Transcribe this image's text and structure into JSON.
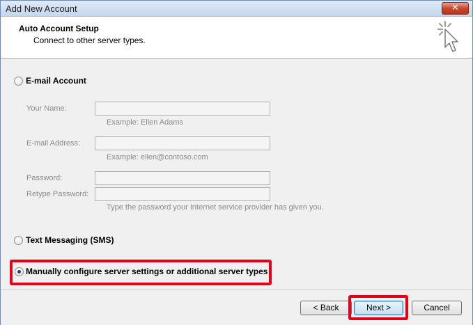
{
  "window": {
    "title": "Add New Account",
    "close_glyph": "✕"
  },
  "header": {
    "title": "Auto Account Setup",
    "subtitle": "Connect to other server types.",
    "icon": "wizard-cursor-icon"
  },
  "options": {
    "email": {
      "label": "E-mail Account",
      "selected": false
    },
    "sms": {
      "label": "Text Messaging (SMS)",
      "selected": false
    },
    "manual": {
      "label": "Manually configure server settings or additional server types",
      "selected": true
    }
  },
  "fields": {
    "name": {
      "label": "Your Name:",
      "value": "",
      "hint": "Example: Ellen Adams"
    },
    "email": {
      "label": "E-mail Address:",
      "value": "",
      "hint": "Example: ellen@contoso.com"
    },
    "password": {
      "label": "Password:",
      "value": ""
    },
    "retype": {
      "label": "Retype Password:",
      "value": "",
      "hint": "Type the password your Internet service provider has given you."
    }
  },
  "buttons": {
    "back": "< Back",
    "next": "Next >",
    "cancel": "Cancel"
  },
  "colors": {
    "highlight": "#e3001b",
    "title_bar": "#c5d6ec"
  }
}
